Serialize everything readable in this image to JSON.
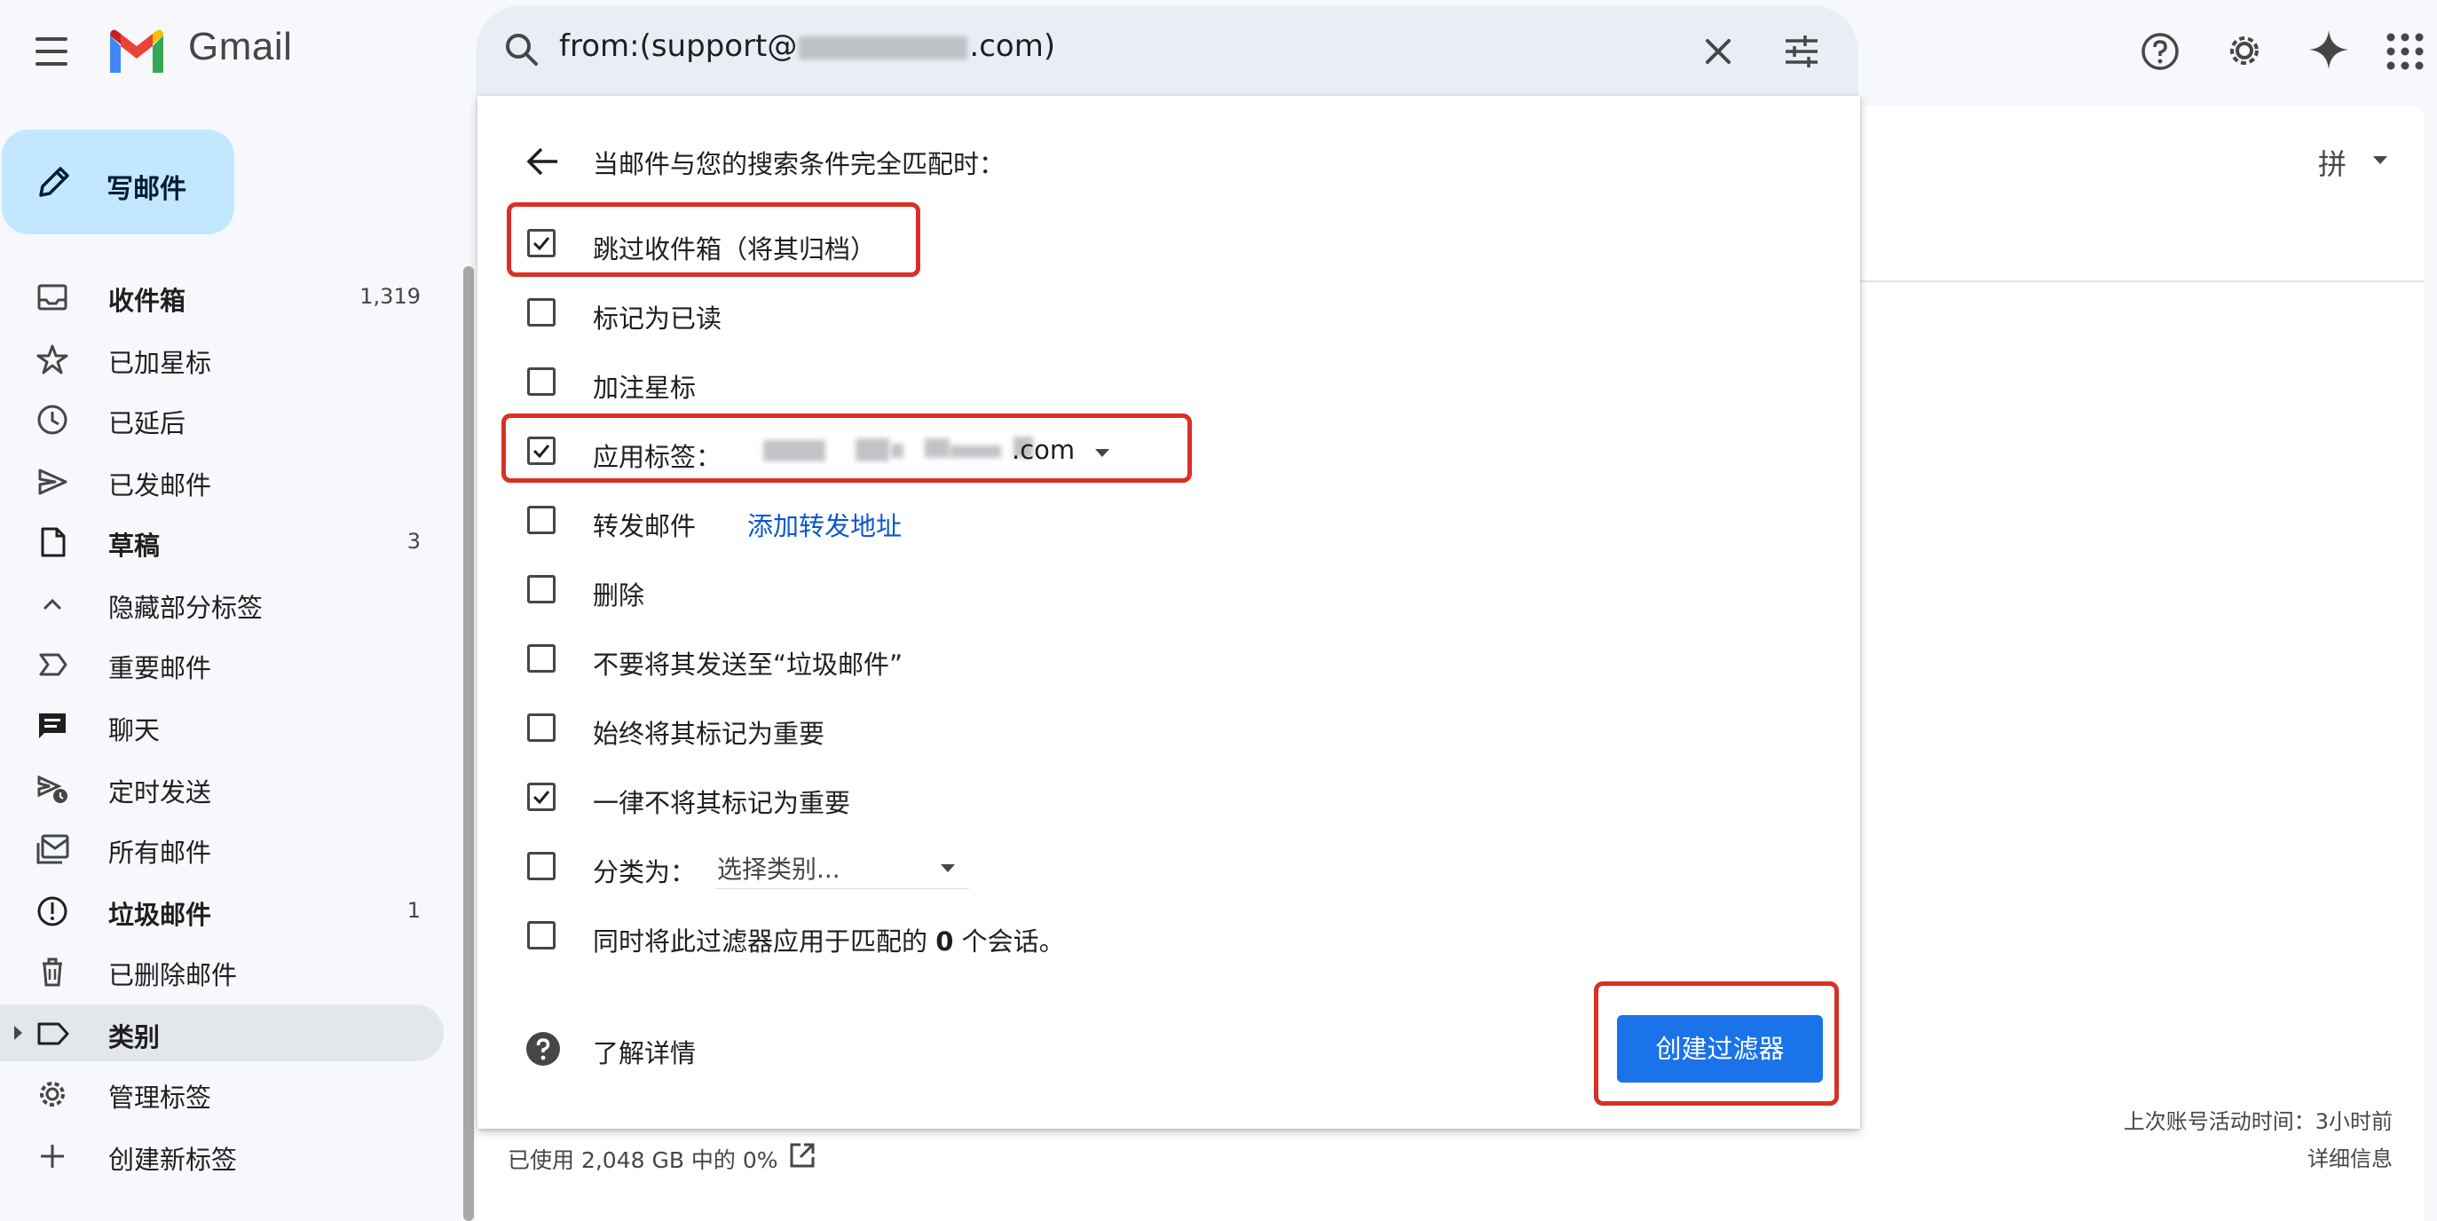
{
  "app": {
    "name": "Gmail"
  },
  "search": {
    "query_visible": "from:(support@",
    "query_suffix": ".com)"
  },
  "header": {
    "help_icon": "help-icon",
    "settings_icon": "gear-icon",
    "gemini_icon": "sparkle-icon",
    "apps_icon": "apps-grid-icon",
    "input_method": "拼"
  },
  "compose": {
    "label": "写邮件"
  },
  "sidebar": {
    "items": [
      {
        "label": "收件箱",
        "count": "1,319",
        "bold": true,
        "icon": "inbox-icon"
      },
      {
        "label": "已加星标",
        "count": "",
        "bold": false,
        "icon": "star-icon"
      },
      {
        "label": "已延后",
        "count": "",
        "bold": false,
        "icon": "clock-icon"
      },
      {
        "label": "已发邮件",
        "count": "",
        "bold": false,
        "icon": "send-icon"
      },
      {
        "label": "草稿",
        "count": "3",
        "bold": true,
        "icon": "draft-icon"
      },
      {
        "label": "隐藏部分标签",
        "count": "",
        "bold": false,
        "icon": "chevron-up-icon"
      },
      {
        "label": "重要邮件",
        "count": "",
        "bold": false,
        "icon": "important-icon"
      },
      {
        "label": "聊天",
        "count": "",
        "bold": false,
        "icon": "chat-icon"
      },
      {
        "label": "定时发送",
        "count": "",
        "bold": false,
        "icon": "scheduled-send-icon"
      },
      {
        "label": "所有邮件",
        "count": "",
        "bold": false,
        "icon": "all-mail-icon"
      },
      {
        "label": "垃圾邮件",
        "count": "1",
        "bold": true,
        "icon": "spam-icon"
      },
      {
        "label": "已删除邮件",
        "count": "",
        "bold": false,
        "icon": "trash-icon"
      },
      {
        "label": "类别",
        "count": "",
        "bold": true,
        "icon": "label-icon"
      },
      {
        "label": "管理标签",
        "count": "",
        "bold": false,
        "icon": "gear-icon"
      },
      {
        "label": "创建新标签",
        "count": "",
        "bold": false,
        "icon": "plus-icon"
      }
    ]
  },
  "filter": {
    "title": "当邮件与您的搜索条件完全匹配时：",
    "options": [
      {
        "label": "跳过收件箱（将其归档）",
        "checked": true
      },
      {
        "label": "标记为已读",
        "checked": false
      },
      {
        "label": "加注星标",
        "checked": false
      },
      {
        "label": "应用标签：",
        "checked": true,
        "select_value": ".com"
      },
      {
        "label": "转发邮件",
        "checked": false,
        "link": "添加转发地址"
      },
      {
        "label": "删除",
        "checked": false
      },
      {
        "label": "不要将其发送至“垃圾邮件”",
        "checked": false
      },
      {
        "label": "始终将其标记为重要",
        "checked": false
      },
      {
        "label": "一律不将其标记为重要",
        "checked": true
      },
      {
        "label": "分类为：",
        "checked": false,
        "select_value": "选择类别..."
      },
      {
        "label_prefix": "同时将此过滤器应用于匹配的 ",
        "label_count": "0",
        "label_suffix": " 个会话。",
        "checked": false
      }
    ],
    "learn_more": "了解详情",
    "create_button": "创建过滤器"
  },
  "footer": {
    "storage": "已使用 2,048 GB 中的 0%",
    "last_activity": "上次账号活动时间：3小时前",
    "details": "详细信息"
  },
  "colors": {
    "highlight": "#d93025",
    "primary_button": "#1a73e8",
    "compose_bg": "#c2e7ff",
    "link": "#0b57d0"
  }
}
